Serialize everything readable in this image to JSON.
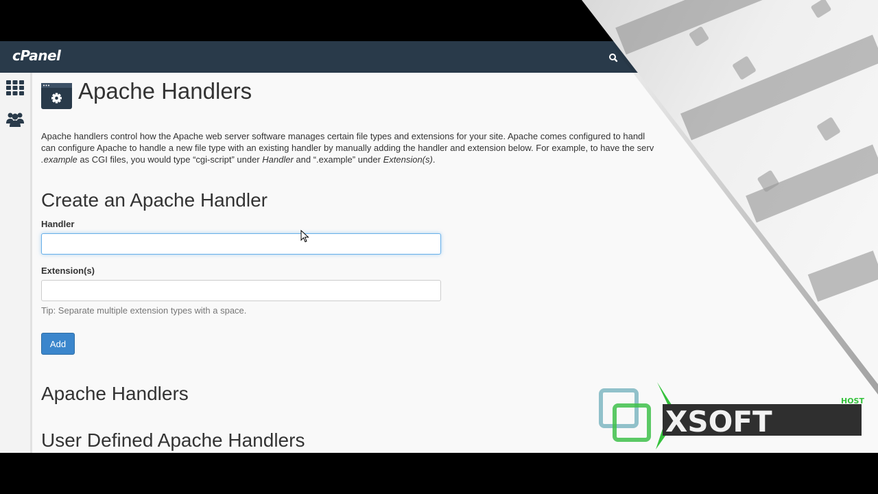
{
  "app": {
    "logo_text": "cPanel",
    "accent": "#293a4a",
    "link_blue": "#3b86cc"
  },
  "icons": {
    "search": "search-icon",
    "grid": "grid-icon",
    "users": "users-icon",
    "page": "apache-handlers-gear-icon"
  },
  "page": {
    "title": "Apache Handlers"
  },
  "description": {
    "line1": "Apache handlers control how the Apache web server software manages certain file types and extensions for your site. Apache comes configured to handl",
    "line2": "can configure Apache to handle a new file type with an existing handler by manually adding the handler and extension below. For example, to have the serv",
    "line3_a": ".example",
    "line3_b": " as CGI files, you would type “cgi-script” under ",
    "line3_c": "Handler",
    "line3_d": " and “.example” under ",
    "line3_e": "Extension(s)",
    "line3_f": "."
  },
  "create": {
    "heading": "Create an Apache Handler",
    "handler_label": "Handler",
    "handler_value": "",
    "extension_label": "Extension(s)",
    "extension_value": "",
    "tip": "Tip: Separate multiple extension types with a space.",
    "add_label": "Add"
  },
  "sections": {
    "apache_handlers": "Apache Handlers",
    "user_defined": "User Defined Apache Handlers"
  },
  "watermark": {
    "brand": "XSOFT",
    "sub": "HOST"
  }
}
